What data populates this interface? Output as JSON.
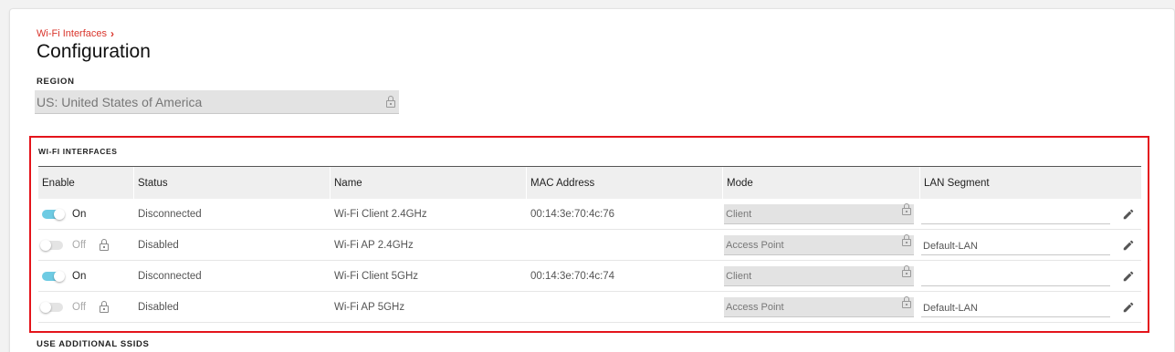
{
  "breadcrumb": {
    "label": "Wi-Fi Interfaces"
  },
  "page": {
    "title": "Configuration"
  },
  "region": {
    "label": "REGION",
    "value": "US: United States of America"
  },
  "wifi_section": {
    "label": "WI-FI INTERFACES",
    "columns": [
      "Enable",
      "Status",
      "Name",
      "MAC Address",
      "Mode",
      "LAN Segment"
    ],
    "rows": [
      {
        "enabled": true,
        "toggle_label": "On",
        "locked": false,
        "status": "Disconnected",
        "name": "Wi-Fi Client 2.4GHz",
        "mac": "00:14:3e:70:4c:76",
        "mode": "Client",
        "lan_segment": ""
      },
      {
        "enabled": false,
        "toggle_label": "Off",
        "locked": true,
        "status": "Disabled",
        "name": "Wi-Fi AP 2.4GHz",
        "mac": "",
        "mode": "Access Point",
        "lan_segment": "Default-LAN"
      },
      {
        "enabled": true,
        "toggle_label": "On",
        "locked": false,
        "status": "Disconnected",
        "name": "Wi-Fi Client 5GHz",
        "mac": "00:14:3e:70:4c:74",
        "mode": "Client",
        "lan_segment": ""
      },
      {
        "enabled": false,
        "toggle_label": "Off",
        "locked": true,
        "status": "Disabled",
        "name": "Wi-Fi AP 5GHz",
        "mac": "",
        "mode": "Access Point",
        "lan_segment": "Default-LAN"
      }
    ]
  },
  "additional_ssids": {
    "label": "USE ADDITIONAL SSIDS"
  },
  "colors": {
    "accent": "#d9342b",
    "highlight": "#e4141b",
    "toggle_on": "#6ecbe3"
  }
}
